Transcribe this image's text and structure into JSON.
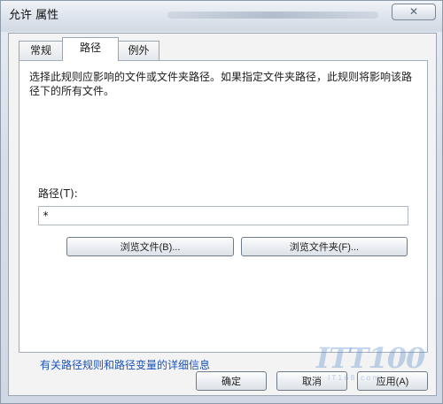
{
  "window": {
    "title": "允许 属性"
  },
  "tabs": [
    {
      "label": "常规"
    },
    {
      "label": "路径",
      "selected": true
    },
    {
      "label": "例外"
    }
  ],
  "panel": {
    "description": "选择此规则应影响的文件或文件夹路径。如果指定文件夹路径，此规则将影响该路径下的所有文件。",
    "path_label": "路径(T):",
    "path_value": "*",
    "browse_file_label": "浏览文件(B)...",
    "browse_folder_label": "浏览文件夹(F)...",
    "help_link": "有关路径规则和路径变量的详细信息"
  },
  "footer": {
    "ok_label": "确定",
    "cancel_label": "取消",
    "apply_label": "应用(A)"
  },
  "watermark": {
    "text": "ITT100",
    "subtext": "IT168.com"
  },
  "icons": {
    "close": "close-icon"
  },
  "colors": {
    "link": "#1b54b8",
    "dialog_background": "#f3f3f3",
    "panel_background": "#ffffff"
  }
}
